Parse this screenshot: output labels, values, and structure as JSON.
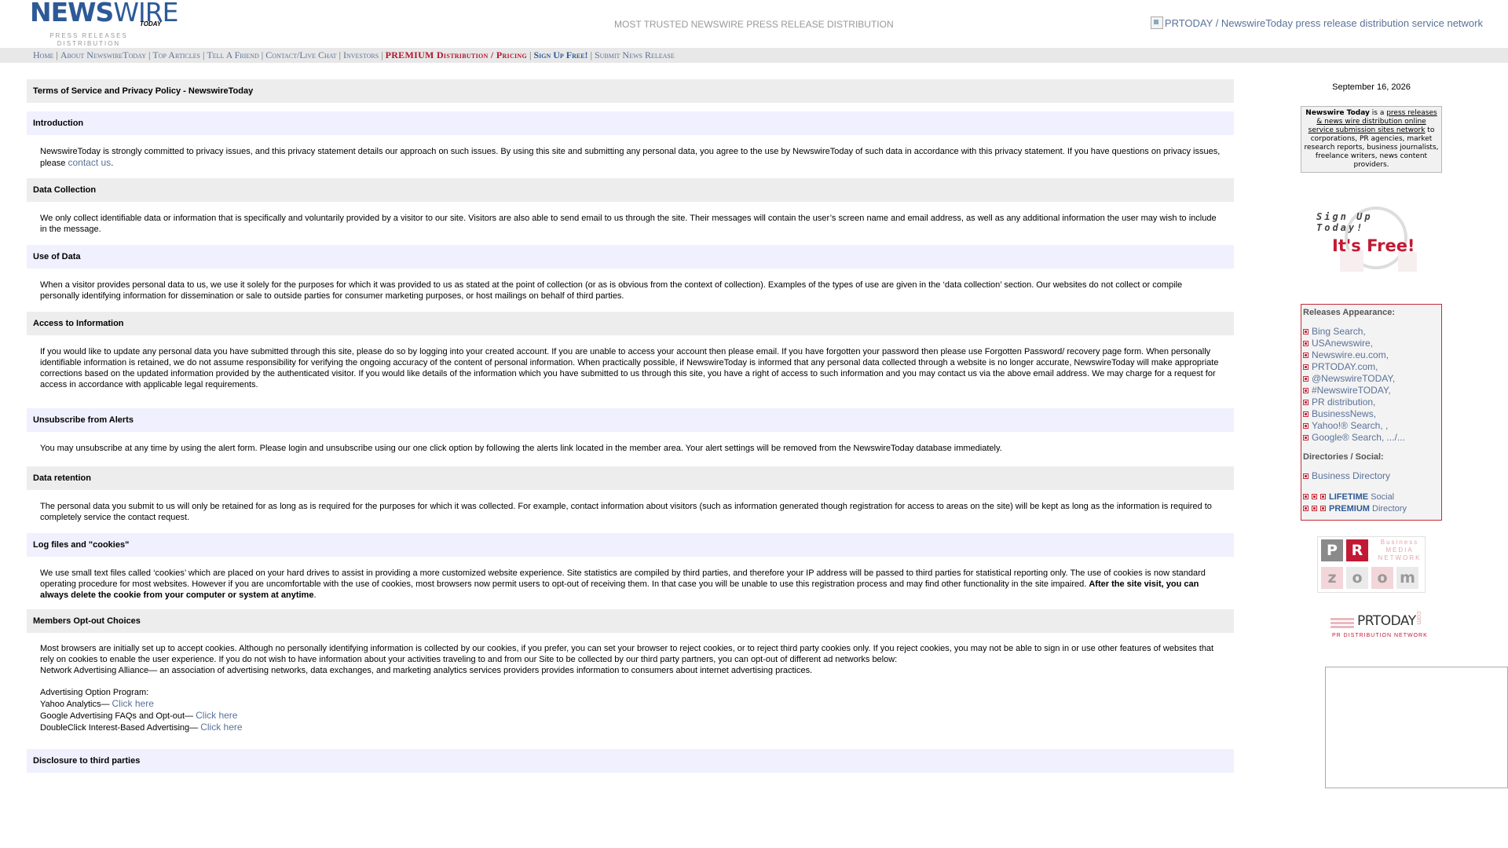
{
  "header": {
    "logo_word1": "NEWS",
    "logo_word2": "WIRE",
    "logo_today": "TODAY",
    "logo_tag_line1": "PRESS RELEASES",
    "logo_tag_line2": "DISTRIBUTION SERVICE",
    "tagline": "MOST TRUSTED NEWSWIRE PRESS RELEASE DISTRIBUTION",
    "network_image_alt": "PRTODAY / NewswireToday press release distribution service network"
  },
  "nav": {
    "home": "Home",
    "about": "About NewswireToday",
    "top_articles": "Top Articles",
    "tell_friend": "Tell A Friend",
    "contact": "Contact/Live Chat",
    "investors": "Investors",
    "premium": "PREMIUM Distribution / Pricing",
    "signup": "Sign Up Free!",
    "submit": "Submit News Release",
    "separator": "|"
  },
  "main": {
    "page_title": "Terms of Service and Privacy Policy - NewswireToday",
    "intro": {
      "heading": "Introduction",
      "text": "NewswireToday is strongly committed to privacy issues, and this privacy statement details our approach on such issues. By using this site and submitting any personal data, you agree to the use by NewswireToday of such data in accordance with this privacy statement. If you have questions on privacy issues, please ",
      "link": "contact us",
      "end": "."
    },
    "collection": {
      "heading": "Data Collection",
      "text": "We only collect identifiable data or information that is specifically and voluntarily provided by a visitor to our site. Visitors are also able to send email to us through the site. Their messages will contain the user’s screen name and email address, as well as any additional information the user may wish to include in the message."
    },
    "use": {
      "heading": "Use of Data",
      "text": "When a visitor provides personal data to us, we use it solely for the purposes for which it was provided to us as stated at the point of collection (or as is obvious from the context of collection). Examples of the types of use are given in the ‘data collection’ section. Our websites do not collect or compile personally identifying information for dissemination or sale to outside parties for consumer marketing purposes, or host mailings on behalf of third parties."
    },
    "access": {
      "heading": "Access to Information",
      "text": "If you would like to update any personal data you have submitted through this site, please do so by logging into your created account. If you are unable to access your account then please email. If you have forgotten your password then please use Forgotten Password/ recovery page form. When personally identifiable information is retained, we do not assume responsibility for verifying the ongoing accuracy of the content of personal information. When practically possible, if NewswireToday is informed that any personal data collected through a website is no longer accurate, NewswireToday will make appropriate corrections based on the updated information provided by the authenticated visitor. If you would like details of the information which you have submitted to us through this site, you have a right of access to such information and you may contact us via the above email address. We may charge for a request for access in accordance with applicable legal requirements."
    },
    "unsubscribe": {
      "heading": "Unsubscribe from Alerts",
      "text": "You may unsubscribe at any time by using the alert form. Please login and unsubscribe using our one click option by following the alerts link located in the member area. Your alert settings will be removed from the NewswireToday database immediately."
    },
    "retention": {
      "heading": "Data retention",
      "text": "The personal data you submit to us will only be retained for as long as is required for the purposes for which it was collected. For example, contact information about visitors (such as information generated though registration for access to areas on the site) will be kept as long as the information is required to completely service the contact request."
    },
    "cookies": {
      "heading": "Log files and \"cookies\"",
      "text": "We use small text files called ‘cookies’ which are placed on your hard drives to assist in providing a more customized website experience. Site statistics are compiled by third parties, and therefore your IP address will be passed to third parties for statistical reporting only. The use of cookies is now standard operating procedure for most websites. However if you are uncomfortable with the use of cookies, most browsers now permit users to opt-out of receiving them. In that case you will be unable to use this registration process and may find other functionality in the site impaired. ",
      "bold": "After the site visit, you can always delete the cookie from your computer or system at anytime",
      "end": "."
    },
    "optout": {
      "heading": "Members Opt-out Choices",
      "text": "Most browsers are initially set up to accept cookies. Although no personally identifying information is collected by our cookies, if you prefer, you can set your browser to reject cookies, or to reject third party cookies only. If you reject cookies, you may not be able to sign in or use other features of websites that rely on cookies to enable the user experience. If you do not wish to have information about your activities traveling to and from our Site to be collected by our third party partners, you can opt-out of different ad networks below:",
      "nai": "Network Advertising Alliance— an association of advertising networks, data exchanges, and marketing analytics services providers provides information to consumers about internet advertising practices.",
      "program_label": "Advertising Option Program:",
      "yahoo_label": "Yahoo Analytics— ",
      "google_label": "Google Advertising FAQs and Opt-out— ",
      "doubleclick_label": "DoubleClick Interest-Based Advertising— ",
      "click_here": "Click here"
    },
    "next_heading": "Disclosure to third parties"
  },
  "sidebar": {
    "date": "September 16, 2026",
    "about_bold": "Newswire Today",
    "about_is": " is a ",
    "about_link": "press releases & news wire distribution online service submission sites network",
    "about_rest": " to corporations, PR agencies, market research reports, business journalists, freelance writers, news content providers.",
    "signup_line1": "Sign Up Today!",
    "signup_line2": "It's Free!",
    "releases_title": "Releases Appearance:",
    "releases": [
      "Bing Search,",
      "USAnewswire,",
      "Newswire.eu.com,",
      "PRTODAY.com,",
      "@NewswireTODAY,",
      "#NewswireTODAY,",
      "PR distribution,",
      "BusinessNews,",
      "Yahoo!® Search, ,",
      "Google® Search, .../..."
    ],
    "directories_title": "Directories / Social:",
    "business_directory": "Business Directory",
    "lifetime_bold": "LIFETIME",
    "lifetime_rest": " Social",
    "premium_bold": "PREMIUM",
    "premium_rest": " Directory",
    "prz_p": "P",
    "prz_r": "R",
    "prz_z": "z",
    "prz_o1": "o",
    "prz_o2": "o",
    "prz_m": "m",
    "prz_net": "Business MEDIA NETWORK",
    "prtoday_word": "PRTODAY",
    "prtoday_com": ".com",
    "prtoday_sub": "PR DISTRIBUTION NETWORK"
  },
  "colors": {
    "link": "#5a7299",
    "brand_blue": "#2d5a97",
    "brand_red": "#c21a34",
    "section_bg_gray": "#ededed",
    "section_bg_lavender": "#f0f0ff"
  }
}
